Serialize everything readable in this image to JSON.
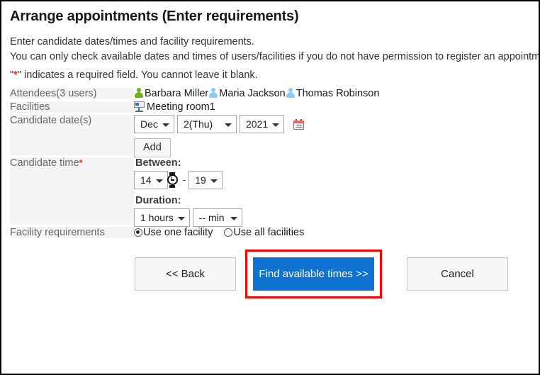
{
  "page": {
    "title": "Arrange appointments (Enter requirements)",
    "description_line1": "Enter candidate dates/times and facility requirements.",
    "description_line2": "You can only check available dates and times of users/facilities if you do not have permission to register an appointment.",
    "required_note_prefix": "\"",
    "required_note_star": "*",
    "required_note_suffix": "\" indicates a required field. You cannot leave it blank."
  },
  "form": {
    "attendees": {
      "label": "Attendees(3 users)",
      "users": [
        {
          "name": "Barbara Miller",
          "icon": "user-icon",
          "icon_color": "#6bb21c"
        },
        {
          "name": "Maria Jackson",
          "icon": "user-icon",
          "icon_color": "#8ecbf0"
        },
        {
          "name": "Thomas Robinson",
          "icon": "user-icon",
          "icon_color": "#8ecbf0"
        }
      ]
    },
    "facilities": {
      "label": "Facilities",
      "items": [
        {
          "name": "Meeting room1",
          "icon": "facility-icon"
        }
      ]
    },
    "candidate_dates": {
      "label": "Candidate date(s)",
      "month_value": "Dec",
      "day_value": "2(Thu)",
      "year_value": "2021",
      "calendar_icon": "calendar-icon",
      "add_label": "Add"
    },
    "candidate_time": {
      "label": "Candidate time",
      "required_marker": "*",
      "between_heading": "Between:",
      "start_hour": "14",
      "separator": "-",
      "end_hour": "19",
      "watch_icon": "watch-cursor-icon",
      "duration_heading": "Duration:",
      "duration_hours": "1 hours",
      "duration_minutes": "-- min"
    },
    "facility_requirements": {
      "label": "Facility requirements",
      "options": [
        {
          "label": "Use one facility",
          "selected": true
        },
        {
          "label": "Use all facilities",
          "selected": false
        }
      ]
    }
  },
  "actions": {
    "back_label": "<< Back",
    "primary_label": "Find available times >>",
    "cancel_label": "Cancel",
    "primary_color": "#0f72d1",
    "highlight_color": "#ff0000"
  }
}
